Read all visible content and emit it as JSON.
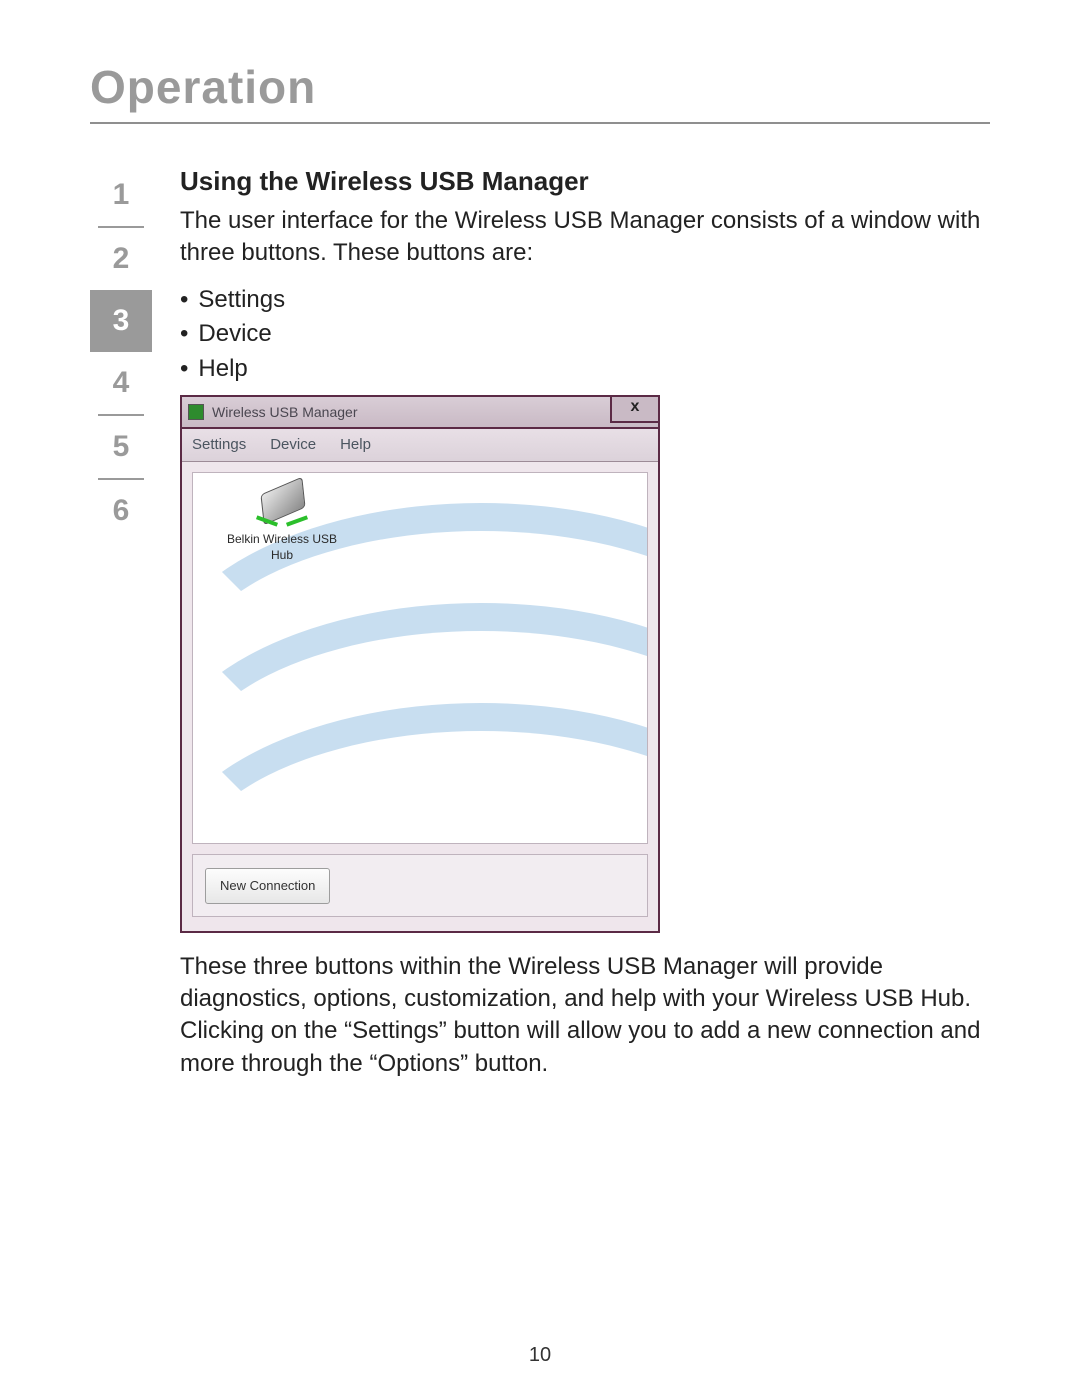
{
  "header": {
    "title": "Operation"
  },
  "side_tabs": {
    "items": [
      "1",
      "2",
      "3",
      "4",
      "5",
      "6"
    ],
    "active_index": 2
  },
  "section": {
    "heading": "Using the Wireless USB Manager",
    "intro": "The user interface for the Wireless USB Manager consists of a window with three buttons. These buttons are:",
    "bullets": [
      "Settings",
      "Device",
      "Help"
    ],
    "after": "These three buttons within the Wireless USB Manager will provide diagnostics, options, customization, and help with your Wireless USB Hub. Clicking on the “Settings” button will allow you to add a new connection and more through the “Options” button."
  },
  "screenshot": {
    "window_title": "Wireless USB Manager",
    "close_glyph": "x",
    "menus": [
      "Settings",
      "Device",
      "Help"
    ],
    "device_label_line1": "Belkin Wireless USB",
    "device_label_line2": "Hub",
    "new_connection_label": "New Connection"
  },
  "page_number": "10"
}
